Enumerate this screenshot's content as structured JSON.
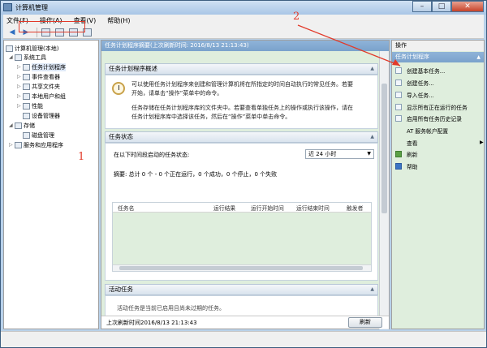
{
  "window": {
    "title": "计算机管理"
  },
  "menu": [
    "文件(F)",
    "操作(A)",
    "查看(V)",
    "帮助(H)"
  ],
  "tree": {
    "root": "计算机管理(本地)",
    "system_tools": "系统工具",
    "task_scheduler": "任务计划程序",
    "event_viewer": "事件查看器",
    "shared_folders": "共享文件夹",
    "local_users": "本地用户和组",
    "performance": "性能",
    "device_manager": "设备管理器",
    "storage": "存储",
    "disk_management": "磁盘管理",
    "services_apps": "服务和应用程序"
  },
  "center": {
    "header": "任务计划程序摘要(上次刷新时间: 2016/8/13 21:13:43)",
    "overview_title": "任务计划程序概述",
    "overview_p1a": "可以使用任务计划程序来创建和管理计算机将在所指定的时间自动执行的常见任务。若要",
    "overview_p1b": "开始，请单击“操作”菜单中的命令。",
    "overview_p2a": "任务存储在任务计划程序库的文件夹中。若要查看单独任务上的操作或执行该操作，请在",
    "overview_p2b": "任务计划程序库中选择该任务，然后在“操作”菜单中单击命令。",
    "status_title": "任务状态",
    "status_prompt": "在以下时间段启动的任务状态:",
    "status_range": "近 24 小时",
    "summary": "摘要: 总计 0 个 - 0 个正在运行，0 个成功，0 个停止，0 个失败",
    "columns": [
      "任务名",
      "运行结果",
      "运行开始时间",
      "运行结束时间",
      "触发者"
    ],
    "active_title": "活动任务",
    "active_partial": "活动任务是当前已启用且尚未过期的任务。",
    "last_refresh": "上次刷新时间2016/8/13 21:13:43",
    "refresh_button": "刷新"
  },
  "actions": {
    "title": "操作",
    "section": "任务计划程序",
    "items": [
      "创建基本任务...",
      "创建任务...",
      "导入任务...",
      "显示所有正在运行的任务",
      "启用所有任务历史记录",
      "AT 服务帐户配置",
      "查看",
      "刷新",
      "帮助"
    ]
  },
  "annotations": {
    "one": "1",
    "two": "2"
  }
}
